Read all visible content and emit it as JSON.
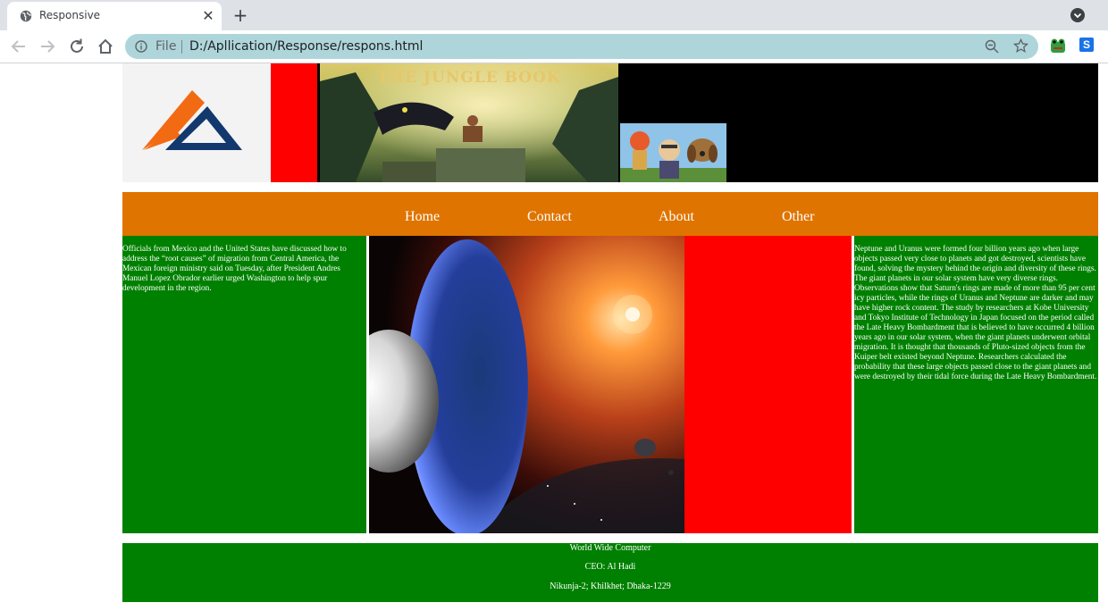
{
  "browser": {
    "tab_title": "Responsive",
    "tab_close": "✕",
    "new_tab": "+",
    "omnibox_scheme": "File",
    "omnibox_url": "D:/Apllication/Response/respons.html",
    "extension_s_label": "S"
  },
  "header": {
    "banner_title": "THE JUNGLE BOOK"
  },
  "nav": {
    "items": [
      "Home",
      "Contact",
      "About",
      "Other"
    ]
  },
  "left_article": {
    "text": "Officials from Mexico and the United States have discussed how to address the “root causes” of migration from Central America, the Mexican foreign ministry said on Tuesday, after President Andres Manuel Lopez Obrador earlier urged Washington to help spur development in the region."
  },
  "right_article": {
    "text": "Neptune and Uranus were formed four billion years ago when large objects passed very close to planets and got destroyed, scientists have found, solving the mystery behind the origin and diversity of these rings. The giant planets in our solar system have very diverse rings. Observations show that Saturn's rings are made of more than 95 per cent icy particles, while the rings of Uranus and Neptune are darker and may have higher rock content. The study by researchers at Kobe University and Tokyo Institute of Technology in Japan focused on the period called the Late Heavy Bombardment that is believed to have occurred 4 billion years ago in our solar system, when the giant planets underwent orbital migration. It is thought that thousands of Pluto-sized objects from the Kuiper belt existed beyond Neptune. Researchers calculated the probability that these large objects passed close to the giant planets and were destroyed by their tidal force during the Late Heavy Bombardment."
  },
  "footer": {
    "company": "World Wide Computer",
    "ceo": "CEO: Al Hadi",
    "address": "Nikunja-2; Khilkhet; Dhaka-1229"
  },
  "colors": {
    "nav_bg": "#e07400",
    "panel_green": "#008000",
    "accent_red": "#ff0000",
    "omnibox_bg": "#aed6da"
  }
}
